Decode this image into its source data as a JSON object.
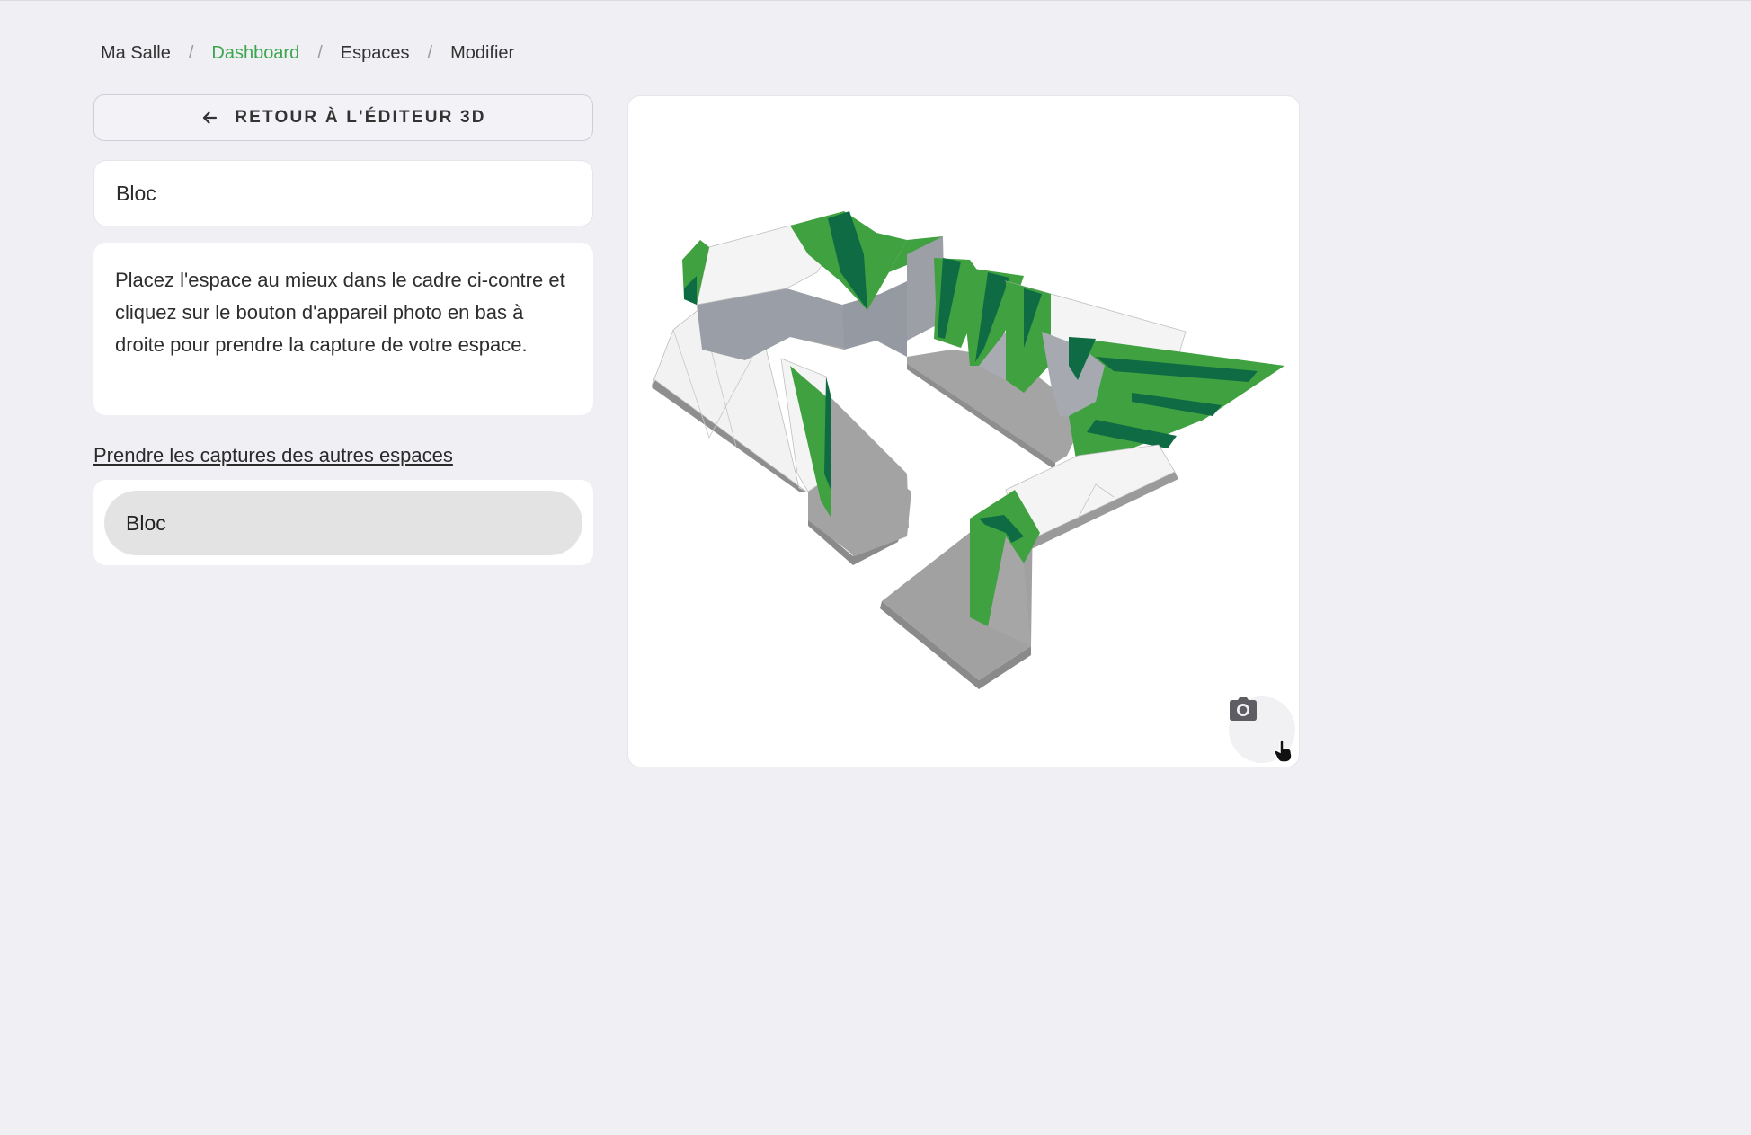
{
  "breadcrumb": {
    "items": [
      {
        "label": "Ma Salle"
      },
      {
        "label": "Dashboard",
        "active_color": "#3aa64e"
      },
      {
        "label": "Espaces"
      },
      {
        "label": "Modifier"
      }
    ],
    "separator": "/"
  },
  "back_button": {
    "label": "RETOUR À L'ÉDITEUR 3D",
    "icon": "arrow-left-icon"
  },
  "space_name": "Bloc",
  "instructions": "Placez l'espace au mieux dans le cadre ci-contre et cliquez sur le bouton d'appareil photo en bas à droite pour prendre la capture de votre espace.",
  "other_spaces": {
    "link_label": "Prendre les captures des autres espaces",
    "items": [
      {
        "label": "Bloc"
      }
    ]
  },
  "viewer": {
    "camera_button_icon": "camera-icon",
    "colors": {
      "wall_green": "#3fa13f",
      "wall_dark_green": "#0e6b44",
      "floor_grey": "#a3a3a3",
      "wall_white": "#f4f4f4"
    }
  }
}
